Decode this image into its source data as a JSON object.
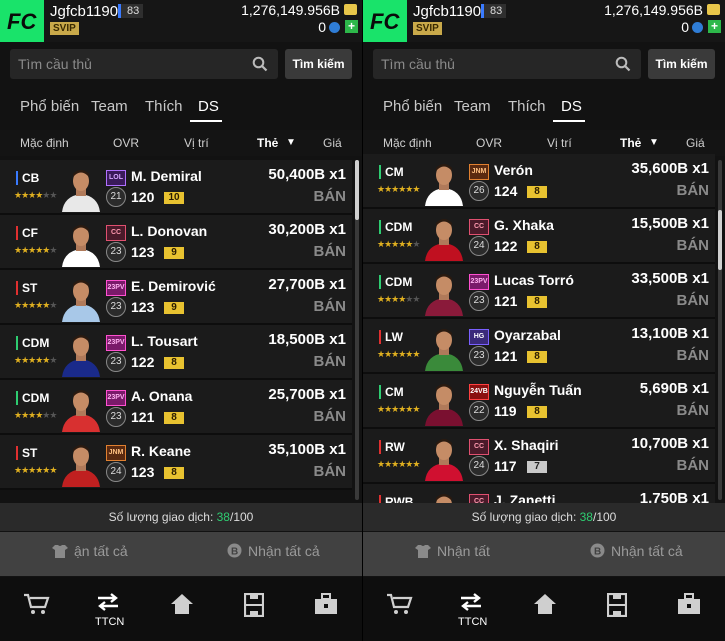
{
  "header": {
    "username": "Jgfcb1190",
    "level": "83",
    "vip": "SVIP",
    "coins": "1,276,149.956B",
    "fc": "0"
  },
  "search": {
    "placeholder": "Tìm cầu thủ",
    "button": "Tìm kiếm"
  },
  "tabs": [
    "Phổ biến",
    "Team",
    "Thích",
    "DS"
  ],
  "columns": [
    "Mặc định",
    "OVR",
    "Vị trí",
    "Thẻ",
    "Giá"
  ],
  "trade": {
    "label": "Số lượng giao dịch:",
    "used": "38",
    "total": "/100"
  },
  "actions_left": {
    "receive": "ận tất cả",
    "collect": "Nhận tất cả"
  },
  "actions_right": {
    "receive": "Nhận tất",
    "collect": "Nhận tất cả"
  },
  "nav": {
    "active_label": "TTCN",
    "icons": [
      "cart-icon",
      "transfer-icon",
      "home-icon",
      "field-icon",
      "toolbox-icon"
    ]
  },
  "left_rows": [
    {
      "pos": "CB",
      "stars": 4,
      "season": "LOL",
      "ovr_circle": "21",
      "name": "M. Demiral",
      "ovr": "120",
      "grade": "10",
      "price": "50,400B x1",
      "sell": "BÁN"
    },
    {
      "pos": "CF",
      "stars": 5,
      "season": "CC",
      "ovr_circle": "23",
      "name": "L. Donovan",
      "ovr": "123",
      "grade": "9",
      "price": "30,200B x1",
      "sell": "BÁN"
    },
    {
      "pos": "ST",
      "stars": 5,
      "season": "23PV",
      "ovr_circle": "23",
      "name": "E. Demirović",
      "ovr": "123",
      "grade": "9",
      "price": "27,700B x1",
      "sell": "BÁN"
    },
    {
      "pos": "CDM",
      "stars": 5,
      "season": "23PV",
      "ovr_circle": "23",
      "name": "L. Tousart",
      "ovr": "122",
      "grade": "8",
      "price": "18,500B x1",
      "sell": "BÁN"
    },
    {
      "pos": "CDM",
      "stars": 4,
      "season": "23PV",
      "ovr_circle": "23",
      "name": "A. Onana",
      "ovr": "121",
      "grade": "8",
      "price": "25,700B x1",
      "sell": "BÁN"
    },
    {
      "pos": "ST",
      "stars": 6,
      "season": "JNM",
      "ovr_circle": "24",
      "name": "R. Keane",
      "ovr": "123",
      "grade": "8",
      "price": "35,100B x1",
      "sell": "BÁN"
    }
  ],
  "right_rows": [
    {
      "pos": "CM",
      "stars": 6,
      "season": "JNM",
      "ovr_circle": "26",
      "name": "Verón",
      "ovr": "124",
      "grade": "8",
      "price": "35,600B x1",
      "sell": "BÁN"
    },
    {
      "pos": "CDM",
      "stars": 5,
      "season": "CC",
      "ovr_circle": "24",
      "name": "G. Xhaka",
      "ovr": "122",
      "grade": "8",
      "price": "15,500B x1",
      "sell": "BÁN"
    },
    {
      "pos": "CDM",
      "stars": 4,
      "season": "23PV",
      "ovr_circle": "23",
      "name": "Lucas Torró",
      "ovr": "121",
      "grade": "8",
      "price": "33,500B x1",
      "sell": "BÁN"
    },
    {
      "pos": "LW",
      "stars": 6,
      "season": "HG",
      "ovr_circle": "23",
      "name": "Oyarzabal",
      "ovr": "121",
      "grade": "8",
      "price": "13,100B x1",
      "sell": "BÁN"
    },
    {
      "pos": "CM",
      "stars": 6,
      "season": "24VB",
      "ovr_circle": "22",
      "name": "Nguyễn Tuấn",
      "ovr": "119",
      "grade": "8",
      "price": "5,690B x1",
      "sell": "BÁN"
    },
    {
      "pos": "RW",
      "stars": 6,
      "season": "CC",
      "ovr_circle": "24",
      "name": "X. Shaqiri",
      "ovr": "117",
      "grade": "7",
      "price": "10,700B x1",
      "sell": "BÁN"
    },
    {
      "pos": "RWB",
      "stars": 5,
      "season": "CC",
      "ovr_circle": "",
      "name": "J. Zanetti",
      "ovr": "",
      "grade": "",
      "price": "1,750B x1",
      "sell": ""
    }
  ]
}
